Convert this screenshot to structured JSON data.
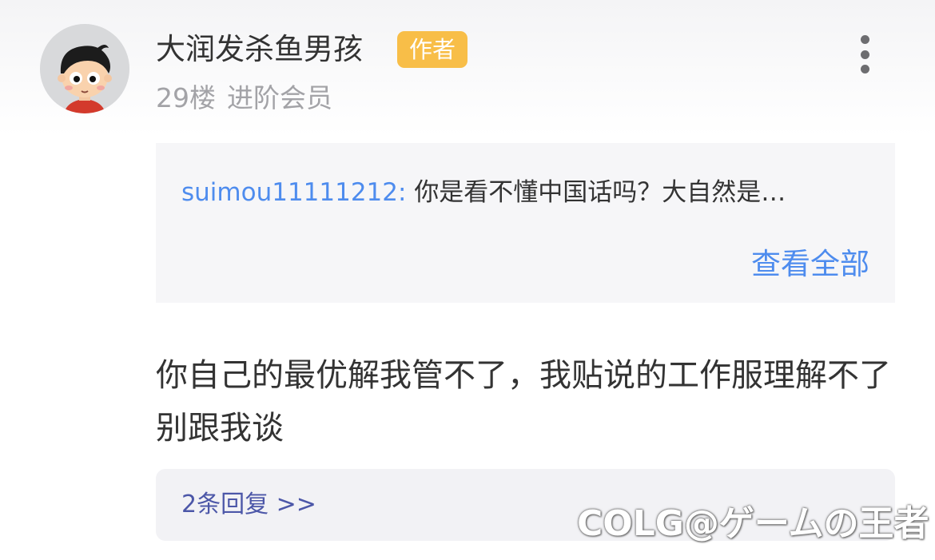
{
  "post": {
    "username": "大润发杀鱼男孩",
    "badge": "作者",
    "floor": "29楼",
    "member_level": "进阶会员",
    "avatar_icon": "cartoon-boy-avatar",
    "more_icon": "vertical-ellipsis-icon"
  },
  "quote": {
    "author": "suimou11111212:",
    "text": "你是看不懂中国话吗？大自然是…",
    "view_all": "查看全部"
  },
  "reply": {
    "text": "你自己的最优解我管不了，我贴说的工作服理解不了别跟我谈"
  },
  "replies": {
    "label": "2条回复 >>"
  },
  "watermark": {
    "text": "COLG@ゲームの王者"
  },
  "colors": {
    "badge": "#f8be48",
    "link": "#4e8cee",
    "replies_link": "#4c57a8",
    "text": "#333333",
    "meta": "#a3a3a7",
    "quote_bg": "#f6f6f8"
  }
}
